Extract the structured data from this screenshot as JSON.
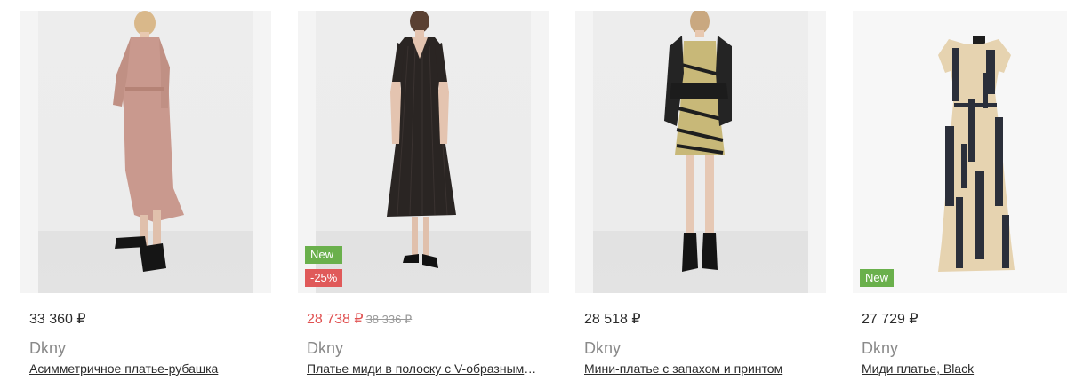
{
  "products": [
    {
      "price": "33 360 ₽",
      "old_price": "",
      "brand": "Dkny",
      "title": "Асимметричное платье-рубашка",
      "badges": [],
      "image_icon": "dress-photo-pink-shirt-dress",
      "dress_color": "#c9998e"
    },
    {
      "price": "28 738 ₽",
      "old_price": "38 336 ₽",
      "brand": "Dkny",
      "title": "Платье миди в полоску с V-образным вырезом",
      "badges": [
        "New",
        "-25%"
      ],
      "image_icon": "dress-photo-black-striped-midi",
      "dress_color": "#2a2523"
    },
    {
      "price": "28 518 ₽",
      "old_price": "",
      "brand": "Dkny",
      "title": "Мини-платье с запахом и принтом",
      "badges": [],
      "image_icon": "dress-photo-mini-wrap-print",
      "dress_color": "#2c2c2c"
    },
    {
      "price": "27 729 ₽",
      "old_price": "",
      "brand": "Dkny",
      "title": "Миди платье, Black",
      "badges": [
        "New"
      ],
      "image_icon": "dress-photo-midi-black-beige-print",
      "dress_color": "#2b2f3a"
    }
  ],
  "colors": {
    "badge_new": "#6ab04c",
    "badge_sale": "#e05a5a",
    "sale_price": "#e05050"
  }
}
